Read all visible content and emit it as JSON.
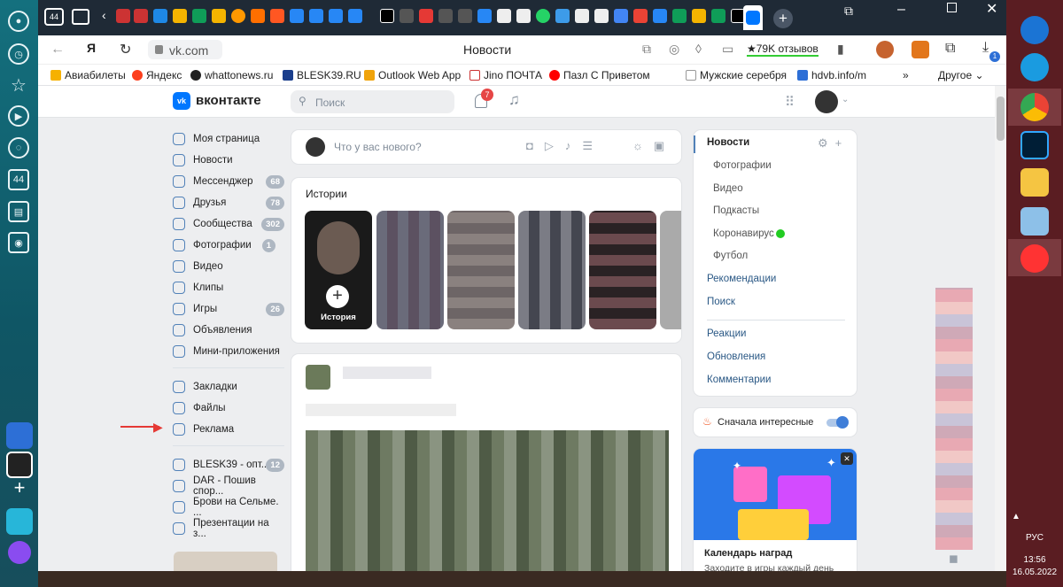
{
  "browser": {
    "tab_count": "44",
    "page_title": "Новости",
    "url": "vk.com",
    "yandex_btn": "Я",
    "reviews": "★79K отзывов",
    "downloads_badge": "1"
  },
  "bookmarks": [
    "Авиабилеты",
    "Яндекс",
    "whattonews.ru",
    "BLESK39.RU",
    "Outlook Web App",
    "Jino ПОЧТА",
    "Пазл С Приветом",
    "Мужские серебря",
    "hdvb.info/m",
    "»",
    "Другое"
  ],
  "vk": {
    "logo": "вконтакте",
    "search_placeholder": "Поиск",
    "notif_count": "7",
    "left_menu": [
      {
        "label": "Моя страница",
        "count": ""
      },
      {
        "label": "Новости",
        "count": ""
      },
      {
        "label": "Мессенджер",
        "count": "68"
      },
      {
        "label": "Друзья",
        "count": "78"
      },
      {
        "label": "Сообщества",
        "count": "302"
      },
      {
        "label": "Фотографии",
        "count": "1"
      },
      {
        "label": "Видео",
        "count": ""
      },
      {
        "label": "Клипы",
        "count": ""
      },
      {
        "label": "Игры",
        "count": "26"
      },
      {
        "label": "Объявления",
        "count": ""
      },
      {
        "label": "Мини-приложения",
        "count": ""
      }
    ],
    "left_menu2": [
      {
        "label": "Закладки"
      },
      {
        "label": "Файлы"
      },
      {
        "label": "Реклама"
      }
    ],
    "groups": [
      {
        "label": "BLESK39 - опт...",
        "count": "12"
      },
      {
        "label": "DAR - Пошив спор..."
      },
      {
        "label": "Брови на Сельме. ..."
      },
      {
        "label": "Презентации на з..."
      }
    ],
    "post_placeholder": "Что у вас нового?",
    "stories_title": "Истории",
    "story_label": "История",
    "right_nav": {
      "news": "Новости",
      "sub": [
        "Фотографии",
        "Видео",
        "Подкасты",
        "Коронавирус",
        "Футбол"
      ],
      "items": [
        "Рекомендации",
        "Поиск"
      ],
      "items2": [
        "Реакции",
        "Обновления",
        "Комментарии"
      ]
    },
    "sort_label": "Сначала интересные",
    "promo_title": "Календарь наград",
    "promo_text": "Заходите в игры каждый день"
  },
  "taskbar": {
    "lang": "РУС",
    "time": "13:56",
    "date": "16.05.2022"
  },
  "colors": {
    "vk_blue": "#0077ff",
    "accent": "#5181b8"
  }
}
